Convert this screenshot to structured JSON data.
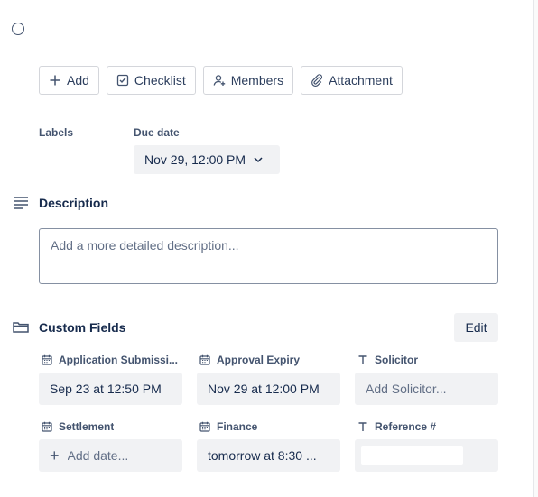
{
  "actions": {
    "add": "Add",
    "checklist": "Checklist",
    "members": "Members",
    "attachment": "Attachment"
  },
  "labels_heading": "Labels",
  "due_date": {
    "heading": "Due date",
    "value": "Nov 29, 12:00 PM"
  },
  "description": {
    "title": "Description",
    "placeholder": "Add a more detailed description..."
  },
  "custom_fields": {
    "title": "Custom Fields",
    "edit_label": "Edit",
    "fields": [
      {
        "label": "Application Submissi...",
        "value": "Sep 23 at 12:50 PM",
        "icon": "calendar-icon"
      },
      {
        "label": "Approval Expiry",
        "value": "Nov 29 at 12:00 PM",
        "icon": "calendar-icon"
      },
      {
        "label": "Solicitor",
        "value": "Add Solicitor...",
        "icon": "text-icon"
      },
      {
        "label": "Settlement",
        "value": "Add date...",
        "icon": "calendar-icon"
      },
      {
        "label": "Finance",
        "value": "tomorrow at 8:30 ...",
        "icon": "calendar-icon"
      },
      {
        "label": "Reference #",
        "value": "",
        "icon": "text-icon"
      }
    ]
  }
}
